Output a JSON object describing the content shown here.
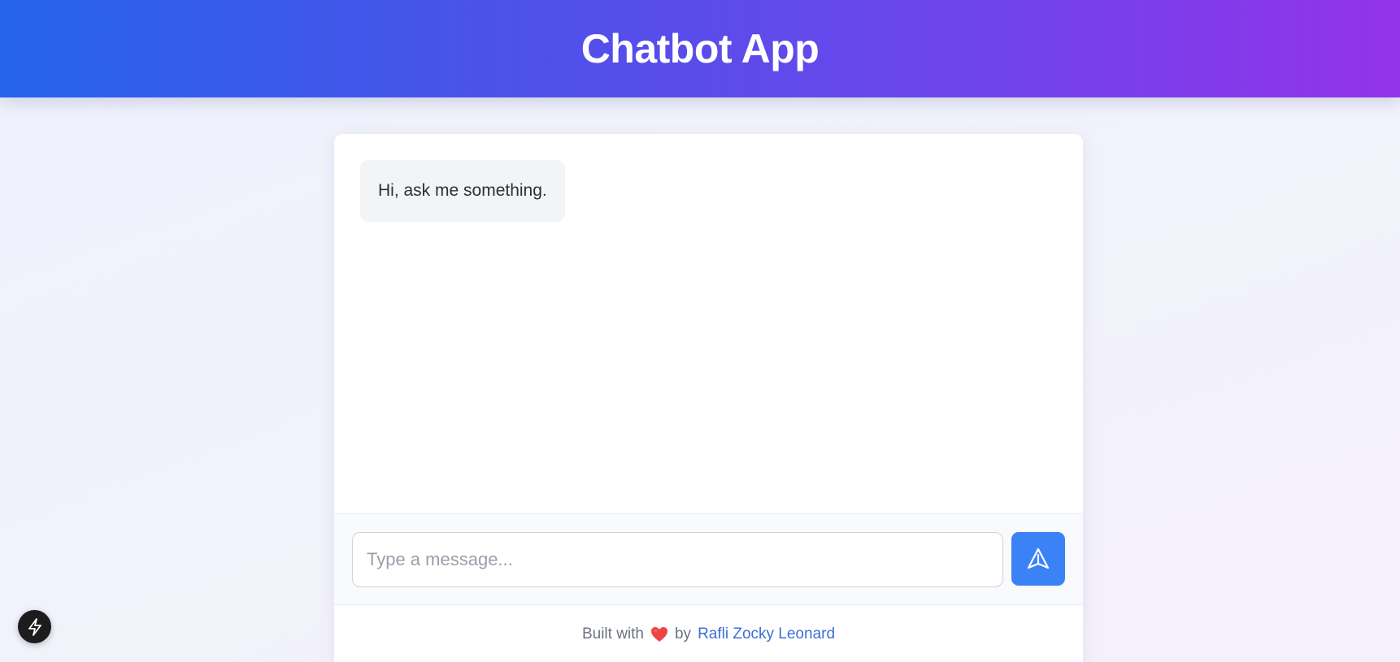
{
  "header": {
    "title": "Chatbot App"
  },
  "chat": {
    "messages": [
      {
        "role": "bot",
        "text": "Hi, ask me something."
      }
    ]
  },
  "composer": {
    "value": "",
    "placeholder": "Type a message...",
    "send_icon": "send-icon"
  },
  "footer": {
    "prefix": "Built with",
    "heart_icon": "heart-icon",
    "by": "by",
    "author": "Rafli Zocky Leonard"
  },
  "dev_badge": {
    "icon": "lightning-icon"
  },
  "colors": {
    "header_gradient_start": "#2563eb",
    "header_gradient_end": "#9333ea",
    "send_button": "#3b82f6",
    "link": "#3b6fd6",
    "heart": "#ef4444",
    "bot_bubble": "#f3f4f6"
  }
}
